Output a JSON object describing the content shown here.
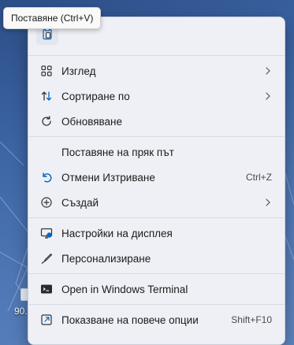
{
  "tooltip": {
    "text": "Поставяне (Ctrl+V)"
  },
  "paste_button": {
    "icon": "paste-icon"
  },
  "desktop": {
    "icon_label": "90."
  },
  "menu": {
    "groups": [
      [
        {
          "label": "Изглед",
          "icon": "grid-icon",
          "submenu": true
        },
        {
          "label": "Сортиране по",
          "icon": "sort-icon",
          "submenu": true
        },
        {
          "label": "Обновяване",
          "icon": "refresh-icon"
        }
      ],
      [
        {
          "label": "Поставяне на пряк път",
          "icon": ""
        },
        {
          "label": "Отмени Изтриване",
          "icon": "undo-icon",
          "shortcut": "Ctrl+Z"
        },
        {
          "label": "Създай",
          "icon": "add-icon",
          "submenu": true
        }
      ],
      [
        {
          "label": "Настройки на дисплея",
          "icon": "display-icon"
        },
        {
          "label": "Персонализиране",
          "icon": "brush-icon"
        }
      ],
      [
        {
          "label": "Open in Windows Terminal",
          "icon": "terminal-icon"
        }
      ],
      [
        {
          "label": "Показване на повече опции",
          "icon": "more-options-icon",
          "shortcut": "Shift+F10"
        }
      ]
    ]
  },
  "colors": {
    "accent": "#0067c0",
    "menu_bg": "#eef0f6",
    "wallpaper": "#3d66a6"
  }
}
